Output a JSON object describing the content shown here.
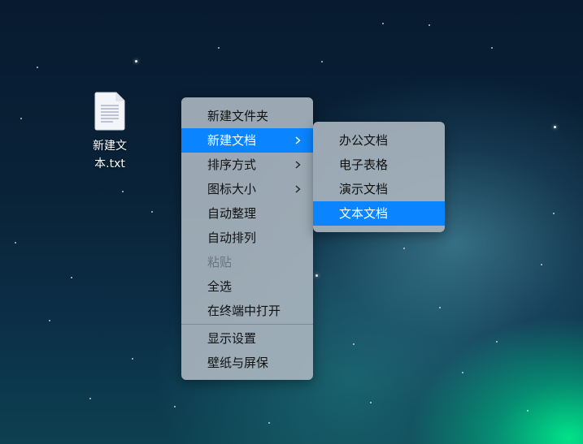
{
  "desktop": {
    "file_name": "新建文本.txt"
  },
  "context_menu": {
    "items": [
      {
        "label": "新建文件夹"
      },
      {
        "label": "新建文档"
      },
      {
        "label": "排序方式"
      },
      {
        "label": "图标大小"
      },
      {
        "label": "自动整理"
      },
      {
        "label": "自动排列"
      },
      {
        "label": "粘贴"
      },
      {
        "label": "全选"
      },
      {
        "label": "在终端中打开"
      },
      {
        "label": "显示设置"
      },
      {
        "label": "壁纸与屏保"
      }
    ],
    "highlighted": "新建文档",
    "disabled": [
      "粘贴"
    ]
  },
  "submenu": {
    "items": [
      {
        "label": "办公文档"
      },
      {
        "label": "电子表格"
      },
      {
        "label": "演示文档"
      },
      {
        "label": "文本文档"
      }
    ],
    "highlighted": "文本文档"
  },
  "colors": {
    "highlight": "#0a84ff",
    "menu_bg": "#a8b4be"
  }
}
